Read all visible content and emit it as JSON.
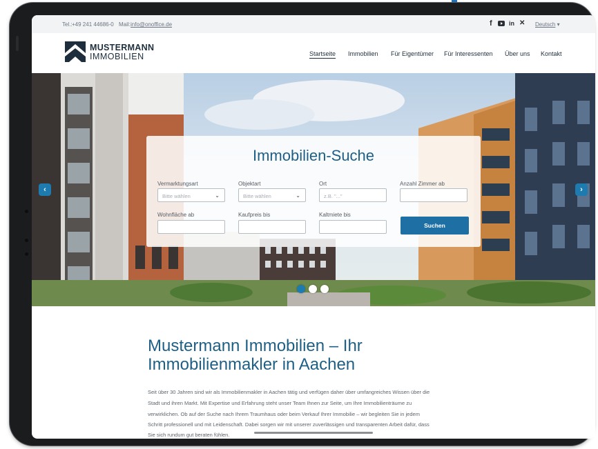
{
  "topbar": {
    "phone_label": "Tel.:",
    "phone": "+49 241 44686-0",
    "mail_label": "Mail:",
    "mail": "info@onoffice.de",
    "language": "Deutsch"
  },
  "header": {
    "logo_title": "MUSTERMANN",
    "logo_subtitle": "IMMOBILIEN",
    "nav": [
      "Startseite",
      "Immobilien",
      "Für Eigentümer",
      "Für Interessenten",
      "Über uns",
      "Kontakt"
    ],
    "active_nav": "Startseite"
  },
  "search": {
    "title": "Immobilien-Suche",
    "fields": [
      {
        "label": "Vermarktungsart",
        "placeholder": "Bitte wählen"
      },
      {
        "label": "Objektart",
        "placeholder": "Bitte wählen"
      },
      {
        "label": "Ort",
        "placeholder": "z.B. \"...\""
      },
      {
        "label": "Anzahl Zimmer ab",
        "placeholder": ""
      },
      {
        "label": "Wohnfläche ab",
        "placeholder": ""
      },
      {
        "label": "Kaufpreis bis",
        "placeholder": ""
      },
      {
        "label": "Kaltmiete bis",
        "placeholder": ""
      }
    ],
    "button": "Suchen"
  },
  "slider": {
    "prev": "‹",
    "next": "›",
    "total_slides": 3,
    "active_slide": 1
  },
  "content": {
    "heading_line1": "Mustermann Immobilien – Ihr",
    "heading_line2": "Immobilienmakler in Aachen",
    "paragraph_lines": [
      "Seit über 30 Jahren sind wir als Immobilienmakler in Aachen tätig und verfügen daher über umfangreiches Wissen über die",
      "Stadt und ihren Markt. Mit Expertise und Erfahrung steht unser Team Ihnen zur Seite, um Ihre Immobilienträume zu",
      "verwirklichen. Ob auf der Suche nach Ihrem Traumhaus oder beim Verkauf Ihrer Immobilie – wir begleiten Sie in jedem",
      "Schritt professionell und mit Leidenschaft. Dabei sorgen wir mit unserer zuverlässigen und transparenten Arbeit dafür, dass",
      "Sie sich rundum gut beraten fühlen."
    ]
  },
  "colors": {
    "brand": "#1e5f86",
    "button": "#1e6fa4",
    "navy": "#1e2e3c"
  },
  "icons": [
    "facebook-icon",
    "youtube-icon",
    "linkedin-icon",
    "xing-icon",
    "chevron-down-icon",
    "arrow-left-icon",
    "arrow-right-icon"
  ]
}
